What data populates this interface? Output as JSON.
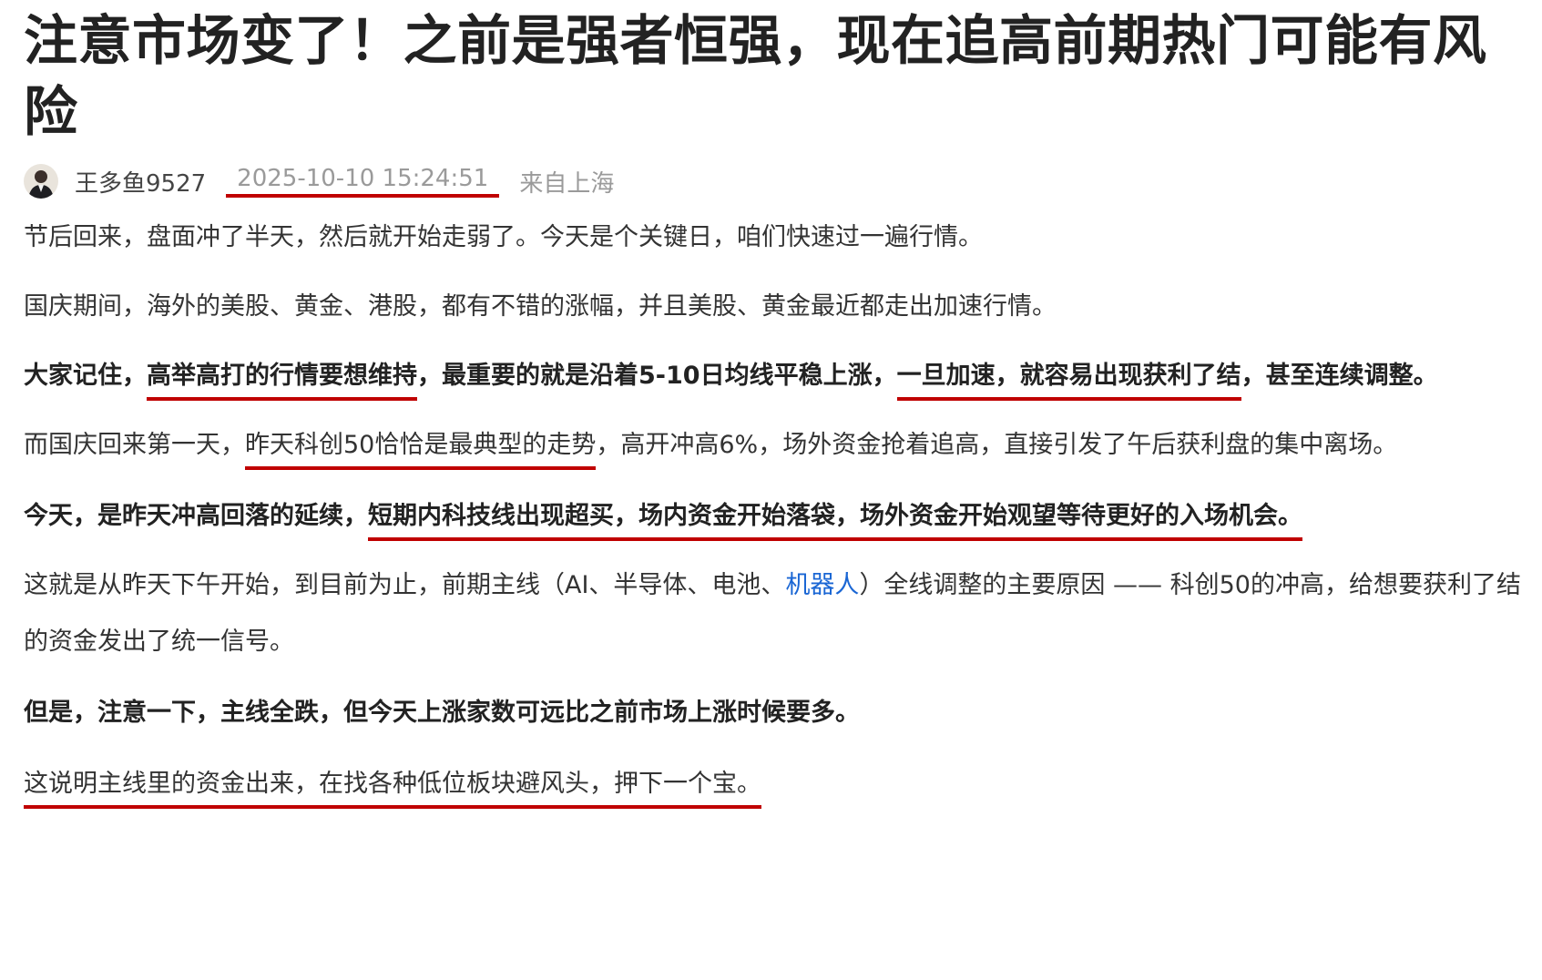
{
  "article": {
    "title": "注意市场变了！之前是强者恒强，现在追高前期热门可能有风险",
    "author": "王多鱼9527",
    "timestamp": "2025-10-10 15:24:51",
    "location": "来自上海",
    "paragraphs": {
      "p1": "节后回来，盘面冲了半天，然后就开始走弱了。今天是个关键日，咱们快速过一遍行情。",
      "p2": "国庆期间，海外的美股、黄金、港股，都有不错的涨幅，并且美股、黄金最近都走出加速行情。",
      "p3": {
        "s1": "大家记住，",
        "s2": "高举高打的行情要想维持",
        "s3": "，最重要的就是沿着5-10日均线平稳上涨，",
        "s4": "一旦加速，就容易出现获利了结",
        "s5": "，甚至连续调整。"
      },
      "p4": {
        "s1": "而国庆回来第一天，",
        "s2": "昨天科创50恰恰是最典型的走势",
        "s3": "，高开冲高6%，场外资金抢着追高，直接引发了午后获利盘的集中离场。"
      },
      "p5": {
        "s1": "今天，是昨天冲高回落的延续，",
        "s2": "短期内科技线出现超买，场内资金开始落袋，场外资金开始观望等待更好的入场机会。"
      },
      "p6": {
        "s1": "这就是从昨天下午开始，到目前为止，前期主线（AI、半导体、电池、",
        "link": "机器人",
        "s2": "）全线调整的主要原因 —— 科创50的冲高，给想要获利了结的资金发出了统一信号。"
      },
      "p7": "但是，注意一下，主线全跌，但今天上涨家数可远比之前市场上涨时候要多。",
      "p8": "这说明主线里的资金出来，在找各种低位板块避风头，押下一个宝。"
    }
  },
  "icons": {
    "avatar": "author-avatar"
  },
  "colors": {
    "underline": "#c00000",
    "link": "#1a66d4",
    "meta_text": "#9a9a9a",
    "body_text": "#333333"
  }
}
